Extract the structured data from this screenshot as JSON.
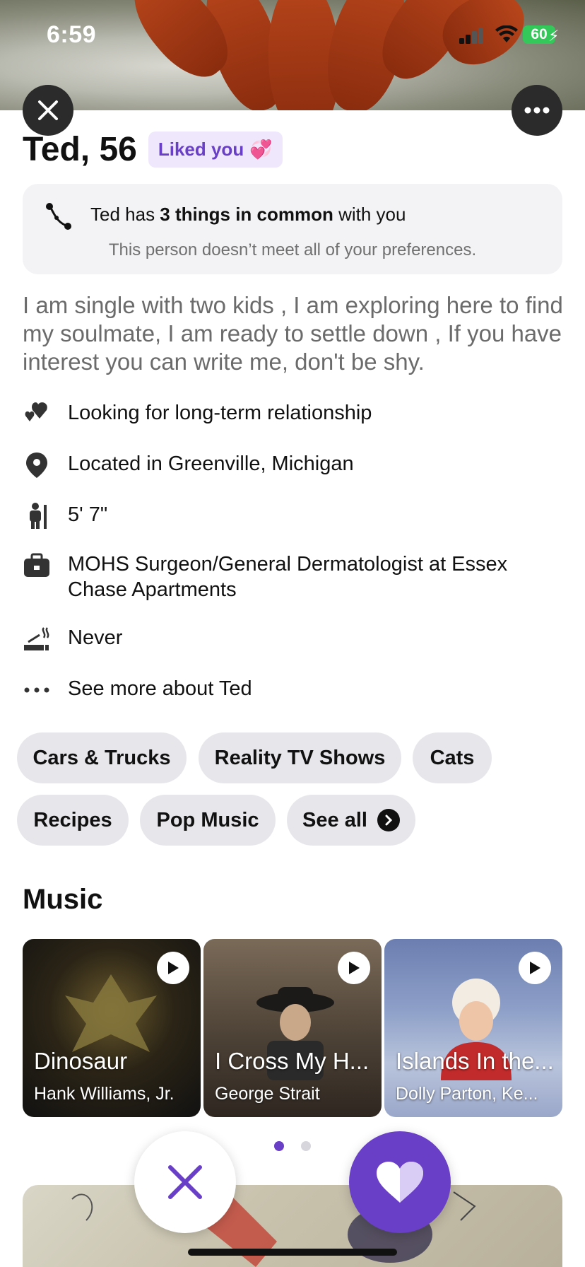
{
  "status_bar": {
    "time": "6:59",
    "battery": "60"
  },
  "profile": {
    "name_age": "Ted, 56",
    "liked_badge": "Liked you",
    "liked_emoji": "💞"
  },
  "common": {
    "prefix": "Ted has ",
    "bold": "3 things in common",
    "suffix": " with you",
    "note": "This person doesn’t meet all of your preferences."
  },
  "bio": "I am single with two kids , I am exploring here to find my soulmate, I am ready to settle down , If you have interest you can write me, don't be shy.",
  "details": [
    {
      "icon": "hearts-icon",
      "text": "Looking for long-term relationship"
    },
    {
      "icon": "location-pin-icon",
      "text": "Located in Greenville, Michigan"
    },
    {
      "icon": "height-icon",
      "text": "5' 7\""
    },
    {
      "icon": "briefcase-icon",
      "text": "MOHS Surgeon/General Dermatologist at Essex Chase Apartments"
    },
    {
      "icon": "smoking-icon",
      "text": "Never"
    },
    {
      "icon": "ellipsis-icon",
      "text": "See more about Ted"
    }
  ],
  "interests": [
    "Cars & Trucks",
    "Reality TV Shows",
    "Cats",
    "Recipes",
    "Pop Music"
  ],
  "see_all": "See all",
  "music": {
    "title": "Music",
    "albums": [
      {
        "song": "Dinosaur",
        "artist": "Hank Williams, Jr."
      },
      {
        "song": "I Cross My H...",
        "artist": "George Strait"
      },
      {
        "song": "Islands In the...",
        "artist": "Dolly Parton, Ke..."
      }
    ]
  },
  "pager": {
    "active": 1,
    "count": 2
  },
  "colors": {
    "accent": "#6a3fc8",
    "chip_bg": "#e7e7eb",
    "badge_bg": "#efe8fd"
  }
}
